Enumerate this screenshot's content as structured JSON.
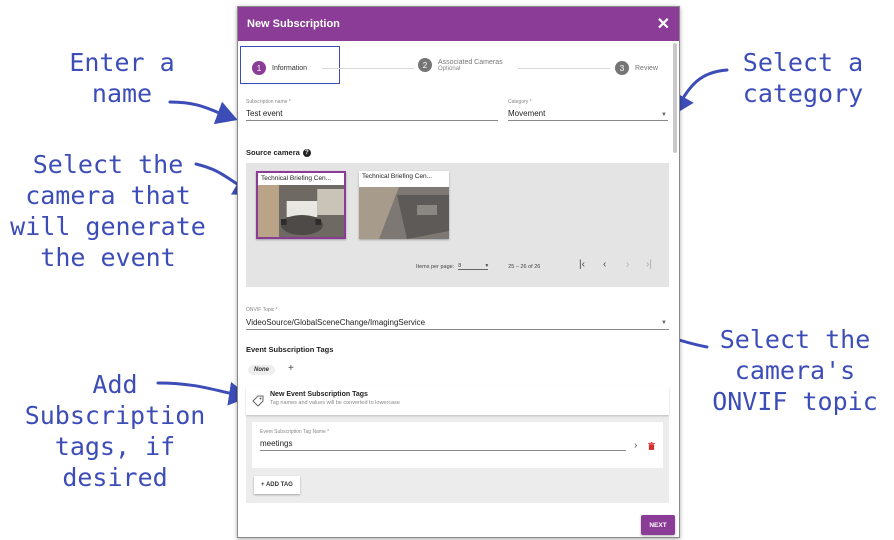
{
  "dialog": {
    "title": "New Subscription",
    "close_icon": "close-icon",
    "accent_color": "#8a3c96"
  },
  "steps": [
    {
      "number": "1",
      "label": "Information",
      "sublabel": "",
      "active": true
    },
    {
      "number": "2",
      "label": "Associated Cameras",
      "sublabel": "Optional",
      "active": false
    },
    {
      "number": "3",
      "label": "Review",
      "sublabel": "",
      "active": false
    }
  ],
  "form": {
    "subscription_name_label": "Subscription name *",
    "subscription_name_value": "Test event",
    "category_label": "Category *",
    "category_value": "Movement",
    "source_camera_label": "Source camera",
    "onvif_topic_label": "ONVIF Topic *",
    "onvif_topic_value": "VideoSource/GlobalSceneChange/ImagingService"
  },
  "cameras": [
    {
      "name": "Technical Briefing Cen...",
      "selected": true
    },
    {
      "name": "Technical Briefing Cen...",
      "selected": false
    }
  ],
  "pagination": {
    "items_per_page_label": "Items per page:",
    "items_per_page_value": "8",
    "range_label": "25 – 26 of 26",
    "first_icon": "first-page-icon",
    "prev_icon": "prev-page-icon",
    "next_icon": "next-page-icon",
    "last_icon": "last-page-icon"
  },
  "tags": {
    "section_label": "Event Subscription Tags",
    "chip_label": "None",
    "plus_label": "+",
    "panel_title": "New Event Subscription Tags",
    "panel_subtitle": "Tag names and values will be converted to lowercase",
    "tag_name_label": "Event Subscription Tag Name *",
    "tag_name_value": "meetings",
    "add_tag_label": "+ ADD TAG"
  },
  "footer": {
    "next_label": "NEXT"
  },
  "callouts": {
    "enter_name": "Enter a\nname",
    "select_category": "Select a\ncategory",
    "select_camera": "Select the\ncamera that\nwill generate\nthe event",
    "select_onvif": "Select the\ncamera's\nONVIF topic",
    "add_tags": "Add\nSubscription\ntags, if\ndesired"
  },
  "callout_color": "#3d4db8"
}
